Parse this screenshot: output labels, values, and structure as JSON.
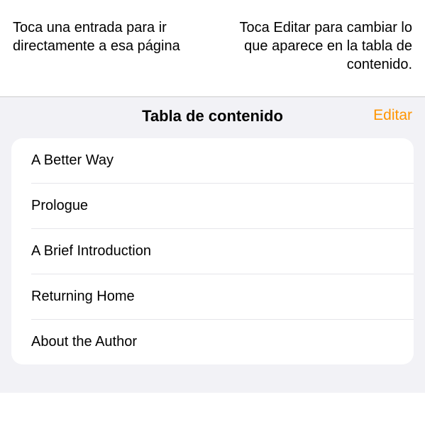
{
  "callouts": {
    "left": "Toca una entrada para ir directamente a esa página",
    "right": "Toca Editar para cambiar lo que aparece en la tabla de contenido."
  },
  "panel": {
    "title": "Tabla de contenido",
    "edit_label": "Editar"
  },
  "toc": {
    "items": [
      {
        "label": "A Better Way"
      },
      {
        "label": "Prologue"
      },
      {
        "label": "A Brief Introduction"
      },
      {
        "label": "Returning Home"
      },
      {
        "label": "About the Author"
      }
    ]
  }
}
